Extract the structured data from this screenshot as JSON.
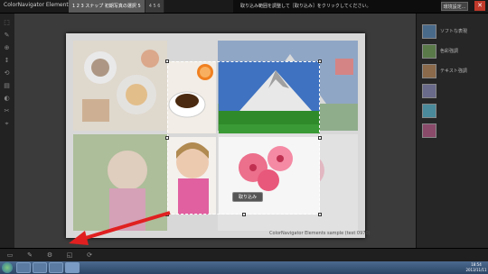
{
  "titlebar": {
    "app_title": "ColorNavigator Elements",
    "steps": [
      "1 2 3 スナップ 初期写真の選択 5",
      "4 5 6"
    ],
    "instruction": "取り込み範囲を調整して［取り込み］をクリックしてください。",
    "top_button": "環境設定...",
    "close_glyph": "✕"
  },
  "crop": {
    "button_label": "取り込み"
  },
  "footer_text": "ColorNavigator Elements sample (test 0970)",
  "right_panel": {
    "items": [
      "ソフトな表現",
      "色彩強調",
      "テキスト強調",
      "",
      "",
      ""
    ]
  },
  "left_tools": [
    "⬚",
    "✎",
    "⊕",
    "↕",
    "⟲",
    "▤",
    "◐",
    "✂",
    "⌖"
  ],
  "bottom_icons": [
    "▭",
    "✎",
    "⚙",
    "◱",
    "⟳"
  ],
  "taskbar": {
    "clock_time": "18:54",
    "clock_date": "2013/11/11"
  },
  "colors": {
    "arrow": "#e02020",
    "close": "#c0392b",
    "crop_frame": "#ffffff"
  }
}
